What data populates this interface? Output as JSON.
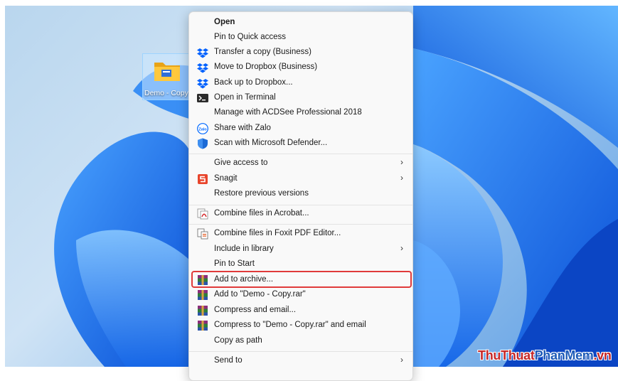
{
  "desktop": {
    "icon_label": "Demo - Copy"
  },
  "context_menu": {
    "items": [
      {
        "label": "Open",
        "icon": "none",
        "bold": true
      },
      {
        "label": "Pin to Quick access",
        "icon": "none"
      },
      {
        "label": "Transfer a copy (Business)",
        "icon": "dropbox-icon"
      },
      {
        "label": "Move to Dropbox (Business)",
        "icon": "dropbox-icon"
      },
      {
        "label": "Back up to Dropbox...",
        "icon": "dropbox-icon"
      },
      {
        "label": "Open in Terminal",
        "icon": "terminal-icon"
      },
      {
        "label": "Manage with ACDSee Professional 2018",
        "icon": "none"
      },
      {
        "label": "Share with Zalo",
        "icon": "zalo-icon"
      },
      {
        "label": "Scan with Microsoft Defender...",
        "icon": "defender-shield-icon"
      },
      {
        "label": "Give access to",
        "icon": "none",
        "submenu": true
      },
      {
        "label": "Snagit",
        "icon": "snagit-icon",
        "submenu": true
      },
      {
        "label": "Restore previous versions",
        "icon": "none"
      },
      {
        "label": "Combine files in Acrobat...",
        "icon": "acrobat-icon"
      },
      {
        "label": "Combine files in Foxit PDF Editor...",
        "icon": "foxit-icon"
      },
      {
        "label": "Include in library",
        "icon": "none",
        "submenu": true
      },
      {
        "label": "Pin to Start",
        "icon": "none"
      },
      {
        "label": "Add to archive...",
        "icon": "winrar-icon",
        "highlighted": true
      },
      {
        "label": "Add to \"Demo - Copy.rar\"",
        "icon": "winrar-icon"
      },
      {
        "label": "Compress and email...",
        "icon": "winrar-icon"
      },
      {
        "label": "Compress to \"Demo - Copy.rar\" and email",
        "icon": "winrar-icon"
      },
      {
        "label": "Copy as path",
        "icon": "none"
      },
      {
        "label": "Send to",
        "icon": "none",
        "submenu": true
      }
    ],
    "submenu_arrow": "›",
    "highlight_color": "#e03a3a"
  },
  "watermark": {
    "part1": "ThuThuat",
    "part2": "PhanMem",
    "part3": ".vn"
  }
}
